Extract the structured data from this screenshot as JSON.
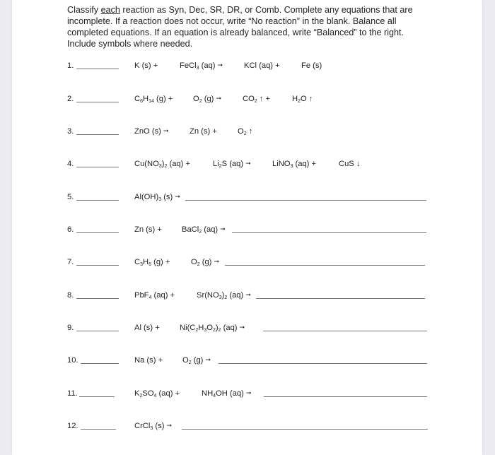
{
  "instructions": {
    "part1": "Classify ",
    "emphasis": "each",
    "part2": " reaction as Syn, Dec, SR, DR, or Comb. Complete any equations that are incomplete. If a reaction does not occur, write “No reaction” in the blank. Balance all completed equations. If an equation is already balanced, write “Balanced” to the right. Include symbols where needed."
  },
  "symbols": {
    "yields": "➞",
    "gas": "↑",
    "precipitate": "↓",
    "plus": "+"
  },
  "reactions": [
    {
      "number": "1.",
      "terms": [
        "K (s) +",
        "FeCl<sub>3</sub> (aq) →",
        "KCl (aq) +",
        "Fe (s)"
      ],
      "complete": true
    },
    {
      "number": "2.",
      "terms": [
        "C<sub>6</sub>H<sub>14</sub> (g) +",
        "O<sub>2</sub> (g) →",
        "CO<sub>2</sub> ↑ +",
        "H<sub>2</sub>O ↑"
      ],
      "complete": true
    },
    {
      "number": "3.",
      "terms": [
        "ZnO (s) →",
        "Zn (s) +",
        "O<sub>2</sub> ↑"
      ],
      "complete": true
    },
    {
      "number": "4.",
      "terms": [
        "Cu(NO<sub>3</sub>)<sub>2</sub> (aq) +",
        "Li<sub>2</sub>S (aq) →",
        "LiNO<sub>3</sub> (aq) +",
        "CuS ↓"
      ],
      "complete": true
    },
    {
      "number": "5.",
      "terms": [
        "Al(OH)<sub>3</sub> (s) →"
      ],
      "complete": false
    },
    {
      "number": "6.",
      "terms": [
        "Zn (s) +",
        "BaCl<sub>2</sub> (aq) →"
      ],
      "complete": false
    },
    {
      "number": "7.",
      "terms": [
        "C<sub>3</sub>H<sub>6</sub> (g) +",
        "O<sub>2</sub> (g) →"
      ],
      "complete": false
    },
    {
      "number": "8.",
      "terms": [
        "PbF<sub>4</sub> (aq) +",
        "Sr(NO<sub>3</sub>)<sub>2</sub> (aq) →"
      ],
      "complete": false
    },
    {
      "number": "9.",
      "terms": [
        "Al (s) +",
        "Ni(C<sub>2</sub>H<sub>3</sub>O<sub>2</sub>)<sub>2</sub> (aq) →"
      ],
      "complete": false
    },
    {
      "number": "10.",
      "terms": [
        "Na (s) +",
        "O<sub>2</sub> (g) →"
      ],
      "complete": false
    },
    {
      "number": "11.",
      "terms": [
        "K<sub>2</sub>SO<sub>4</sub> (aq) +",
        "NH<sub>4</sub>OH (aq) →"
      ],
      "complete": false
    },
    {
      "number": "12.",
      "terms": [
        "CrCl<sub>3</sub> (s) →"
      ],
      "complete": false
    }
  ]
}
